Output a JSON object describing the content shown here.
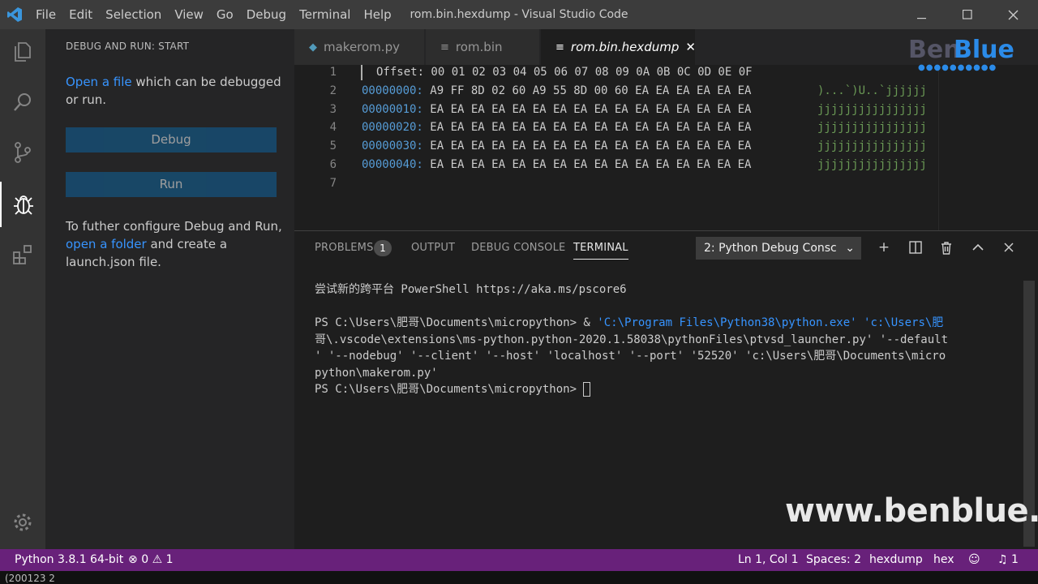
{
  "titlebar": {
    "menu": [
      "File",
      "Edit",
      "Selection",
      "View",
      "Go",
      "Debug",
      "Terminal",
      "Help"
    ],
    "title": "rom.bin.hexdump - Visual Studio Code"
  },
  "sidebar": {
    "title": "DEBUG AND RUN: START",
    "open_file_link": "Open a file",
    "open_file_text": " which can be debugged or run.",
    "debug_label": "Debug",
    "run_label": "Run",
    "configure_text": "To futher configure Debug and Run, ",
    "open_folder_link": "open a folder",
    "configure_text2": " and create a launch.json file."
  },
  "tabs": [
    {
      "label": "makerom.py",
      "icon": "python-file-icon"
    },
    {
      "label": "rom.bin",
      "icon": "file-lines-icon"
    },
    {
      "label": "rom.bin.hexdump",
      "icon": "file-lines-icon",
      "active": true
    }
  ],
  "editor": {
    "line_numbers": [
      "1",
      "2",
      "3",
      "4",
      "5",
      "6",
      "7"
    ],
    "header": "Offset: 00 01 02 03 04 05 06 07 08 09 0A 0B 0C 0D 0E 0F",
    "rows": [
      {
        "offset": "00000000:",
        "bytes": "A9 FF 8D 02 60 A9 55 8D 00 60 EA EA EA EA EA EA",
        "ascii": ")...`)U..`jjjjjj"
      },
      {
        "offset": "00000010:",
        "bytes": "EA EA EA EA EA EA EA EA EA EA EA EA EA EA EA EA",
        "ascii": "jjjjjjjjjjjjjjjj"
      },
      {
        "offset": "00000020:",
        "bytes": "EA EA EA EA EA EA EA EA EA EA EA EA EA EA EA EA",
        "ascii": "jjjjjjjjjjjjjjjj"
      },
      {
        "offset": "00000030:",
        "bytes": "EA EA EA EA EA EA EA EA EA EA EA EA EA EA EA EA",
        "ascii": "jjjjjjjjjjjjjjjj"
      },
      {
        "offset": "00000040:",
        "bytes": "EA EA EA EA EA EA EA EA EA EA EA EA EA EA EA EA",
        "ascii": "jjjjjjjjjjjjjjjj"
      }
    ]
  },
  "panel": {
    "tabs": [
      "PROBLEMS",
      "OUTPUT",
      "DEBUG CONSOLE",
      "TERMINAL"
    ],
    "problems_count": "1",
    "terminal_select": "2: Python Debug Consc",
    "terminal": {
      "line1": "尝试新的跨平台 PowerShell https://aka.ms/pscore6",
      "prompt1": "PS C:\\Users\\肥哥\\Documents\\micropython> & ",
      "cmd1": "'C:\\Program Files\\Python38\\python.exe' 'c:\\Users\\肥",
      "cmd2": "哥\\.vscode\\extensions\\ms-python.python-2020.1.58038\\pythonFiles\\ptvsd_launcher.py' '--default",
      "cmd3": "' '--nodebug' '--client' '--host' 'localhost' '--port' '52520' 'c:\\Users\\肥哥\\Documents\\micro",
      "cmd4": "python\\makerom.py'",
      "prompt2": "PS C:\\Users\\肥哥\\Documents\\micropython> "
    }
  },
  "statusbar": {
    "python": "Python 3.8.1 64-bit",
    "errors": "0",
    "warnings": "1",
    "position": "Ln 1, Col 1",
    "spaces": "Spaces: 2",
    "language": "hexdump",
    "encoding": "hex",
    "notifications": "1"
  },
  "bottom_caption": "(200123 2",
  "watermark": {
    "site": "www.benblue.cn",
    "logo_a": "Ben",
    "logo_b": "Blue"
  }
}
